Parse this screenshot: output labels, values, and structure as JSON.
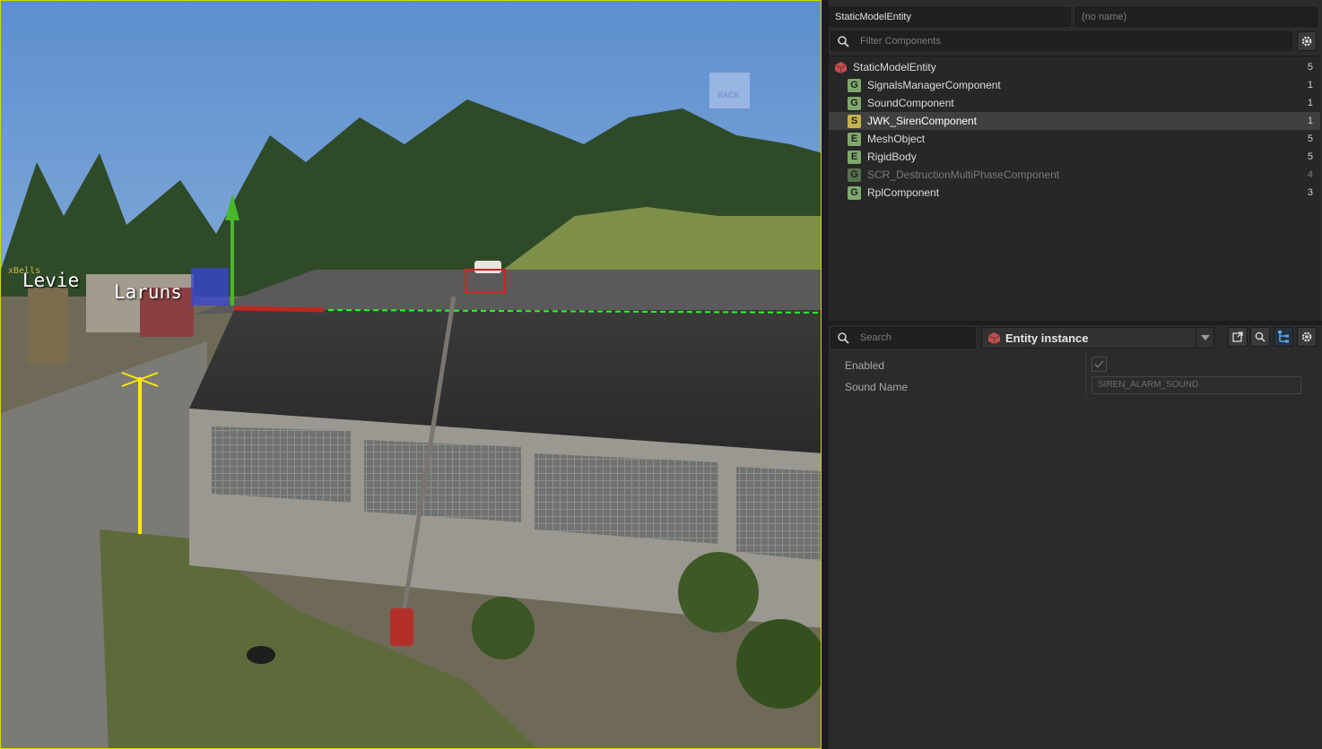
{
  "viewport": {
    "labels": {
      "town1": "Levie",
      "town2": "Laruns",
      "small": "xBells",
      "back": "BACK"
    }
  },
  "inspector": {
    "entity_class": "StaticModelEntity",
    "entity_name": "(no name)",
    "filter_placeholder": "Filter Components",
    "components": [
      {
        "badge": "",
        "name": "StaticModelEntity",
        "count": "5",
        "kind": "root"
      },
      {
        "badge": "G",
        "name": "SignalsManagerComponent",
        "count": "1",
        "kind": "g"
      },
      {
        "badge": "G",
        "name": "SoundComponent",
        "count": "1",
        "kind": "g"
      },
      {
        "badge": "S",
        "name": "JWK_SirenComponent",
        "count": "1",
        "kind": "s"
      },
      {
        "badge": "E",
        "name": "MeshObject",
        "count": "5",
        "kind": "e"
      },
      {
        "badge": "E",
        "name": "RigidBody",
        "count": "5",
        "kind": "e"
      },
      {
        "badge": "G",
        "name": "SCR_DestructionMultiPhaseComponent",
        "count": "4",
        "kind": "g-disabled"
      },
      {
        "badge": "G",
        "name": "RplComponent",
        "count": "3",
        "kind": "g"
      }
    ],
    "selected_component": "JWK_SirenComponent",
    "search_placeholder": "Search",
    "instance_mode": "Entity instance",
    "properties": {
      "enabled_label": "Enabled",
      "enabled_checked": true,
      "sound_label": "Sound Name",
      "sound_value": "SIREN_ALARM_SOUND"
    },
    "icons": [
      "search-icon",
      "gear-icon",
      "cube-icon",
      "chevron-down-icon",
      "external-link-icon",
      "magnify-icon",
      "hierarchy-icon",
      "check-icon"
    ]
  }
}
